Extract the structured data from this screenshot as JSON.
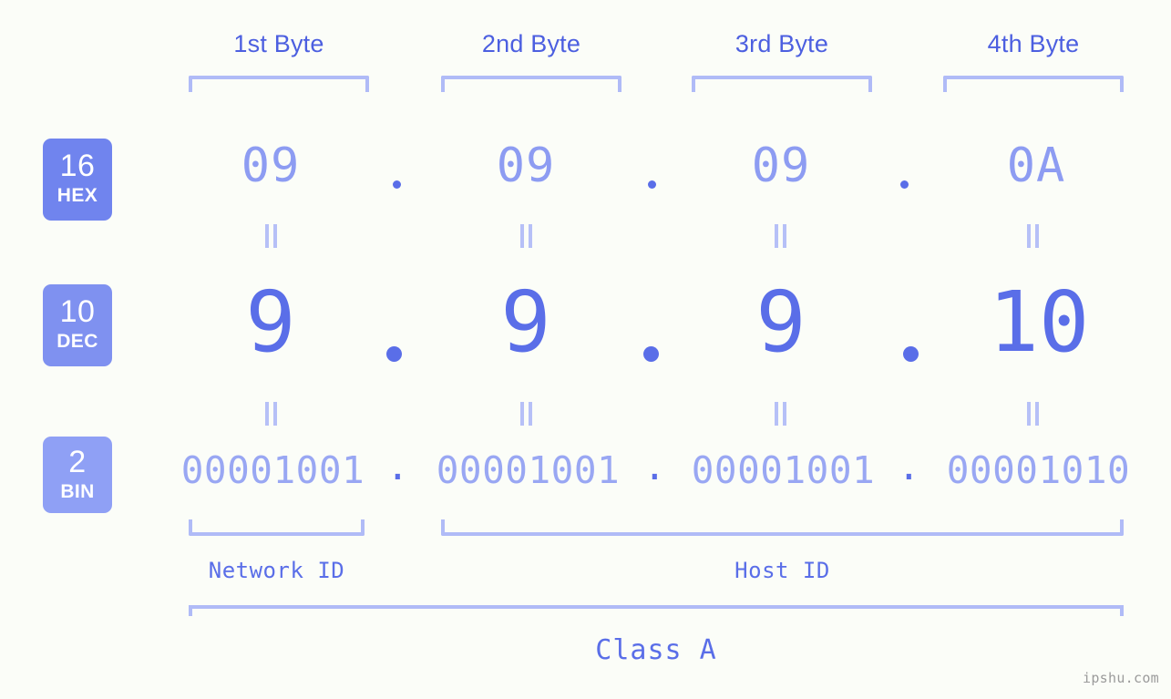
{
  "watermark": "ipshu.com",
  "byte_headers": [
    {
      "label": "1st Byte"
    },
    {
      "label": "2nd Byte"
    },
    {
      "label": "3rd Byte"
    },
    {
      "label": "4th Byte"
    }
  ],
  "bases": [
    {
      "number": "16",
      "abbr": "HEX"
    },
    {
      "number": "10",
      "abbr": "DEC"
    },
    {
      "number": "2",
      "abbr": "BIN"
    }
  ],
  "rows": {
    "hex": {
      "values": [
        "09",
        "09",
        "09",
        "0A"
      ],
      "separator": "."
    },
    "dec": {
      "values": [
        "9",
        "9",
        "9",
        "10"
      ],
      "separator": "."
    },
    "bin": {
      "values": [
        "00001001",
        "00001001",
        "00001001",
        "00001010"
      ],
      "separator": "."
    }
  },
  "equals_mark": "=",
  "segments": [
    {
      "label": "Network ID"
    },
    {
      "label": "Host ID"
    }
  ],
  "class": {
    "label": "Class A"
  },
  "colors": {
    "background": "#fbfdf8",
    "accent_strong": "#5a6ee8",
    "accent_header": "#4c5fe0",
    "accent_mid": "#8d9cf2",
    "accent_light": "#99a7f3",
    "bracket": "#b0bbf7",
    "badge_hex": "#7084ee",
    "badge_dec": "#7f91f0",
    "badge_bin": "#8fa0f5",
    "watermark": "#9b9b9b"
  }
}
